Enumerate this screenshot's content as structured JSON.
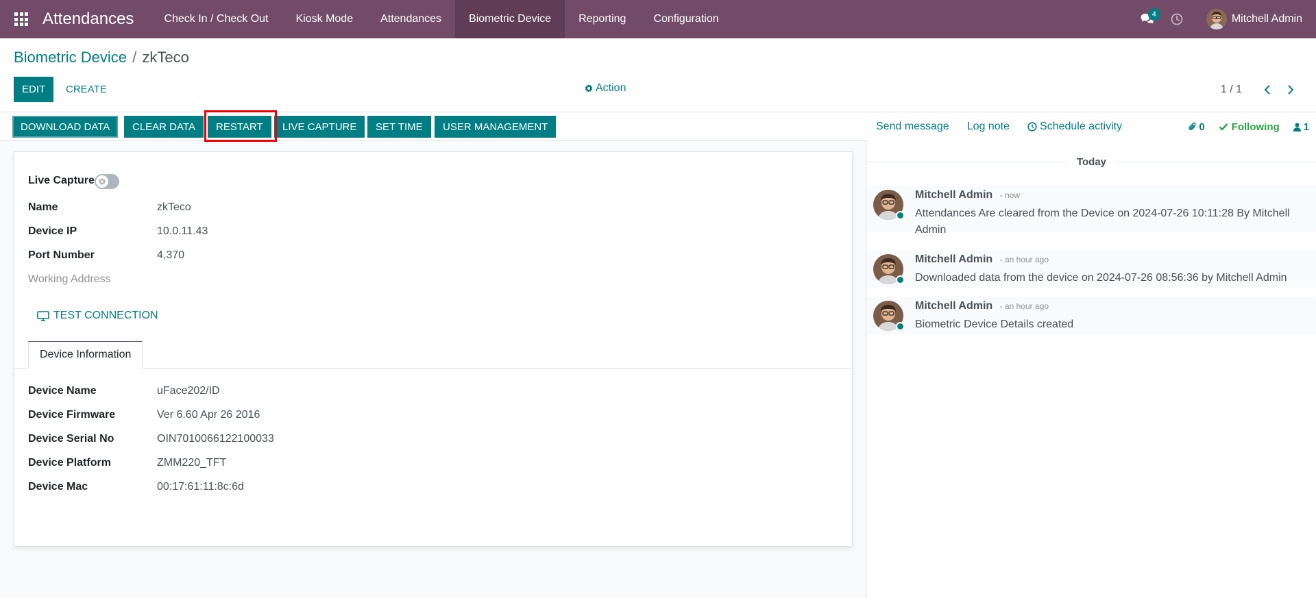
{
  "navbar": {
    "app_name": "Attendances",
    "menu": [
      {
        "label": "Check In / Check Out"
      },
      {
        "label": "Kiosk Mode"
      },
      {
        "label": "Attendances"
      },
      {
        "label": "Biometric Device"
      },
      {
        "label": "Reporting"
      },
      {
        "label": "Configuration"
      }
    ],
    "active_menu": "Biometric Device",
    "chat_badge": "4",
    "user_name": "Mitchell Admin"
  },
  "breadcrumb": {
    "parent": "Biometric Device",
    "separator": "/",
    "current": "zkTeco"
  },
  "toolbar": {
    "edit_label": "EDIT",
    "create_label": "CREATE",
    "action_label": "Action",
    "pager_value": "1 / 1"
  },
  "header_buttons": {
    "download": "DOWNLOAD DATA",
    "clear": "CLEAR DATA",
    "restart": "RESTART",
    "live_capture": "LIVE CAPTURE",
    "set_time": "SET TIME",
    "user_management": "USER MANAGEMENT"
  },
  "form": {
    "live_capture_label": "Live Capture",
    "live_capture_on": false,
    "fields": {
      "name": {
        "label": "Name",
        "value": "zkTeco"
      },
      "device_ip": {
        "label": "Device IP",
        "value": "10.0.11.43"
      },
      "port": {
        "label": "Port Number",
        "value": "4,370"
      },
      "working_address": {
        "label": "Working Address",
        "value": ""
      }
    },
    "test_connection_label": "TEST CONNECTION",
    "tab_label": "Device Information",
    "device_info": {
      "device_name": {
        "label": "Device Name",
        "value": "uFace202/ID"
      },
      "firmware": {
        "label": "Device Firmware",
        "value": "Ver 6.60 Apr 26 2016"
      },
      "serial": {
        "label": "Device Serial No",
        "value": "OIN7010066122100033"
      },
      "platform": {
        "label": "Device Platform",
        "value": "ZMM220_TFT"
      },
      "mac": {
        "label": "Device Mac",
        "value": "00:17:61:11:8c:6d"
      }
    }
  },
  "chatter": {
    "send_message": "Send message",
    "log_note": "Log note",
    "schedule_activity": "Schedule activity",
    "attachments_count": "0",
    "following_label": "Following",
    "followers_count": "1",
    "today_label": "Today",
    "messages": [
      {
        "author": "Mitchell Admin",
        "date": "- now",
        "body": "Attendances Are cleared from the Device on 2024-07-26 10:11:28 By Mitchell Admin"
      },
      {
        "author": "Mitchell Admin",
        "date": "- an hour ago",
        "body": "Downloaded data from the device on 2024-07-26 08:56:36 by Mitchell Admin"
      },
      {
        "author": "Mitchell Admin",
        "date": "- an hour ago",
        "body": "Biometric Device Details created"
      }
    ]
  },
  "colors": {
    "navbar": "#714b67",
    "primary": "#017e84",
    "following": "#28a745",
    "highlight": "#ee0000"
  }
}
